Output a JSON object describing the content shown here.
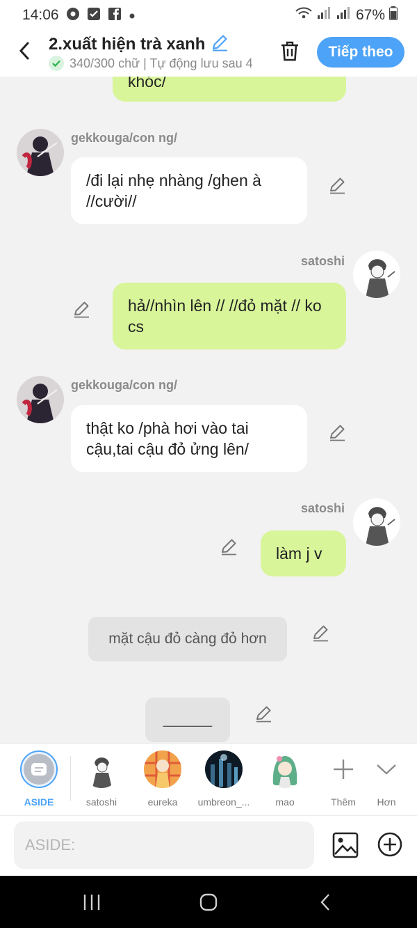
{
  "status_bar": {
    "time": "14:06",
    "battery": "67%"
  },
  "header": {
    "title": "2.xuất hiện trà xanh",
    "subtitle": "340/300 chữ | Tự động lưu sau 4",
    "next_label": "Tiếp theo"
  },
  "messages": [
    {
      "text": "khóc/"
    },
    {
      "speaker": "gekkouga/con ng/",
      "text": "/đi lại nhẹ nhàng /ghen à //cười//"
    },
    {
      "speaker": "satoshi",
      "text": "hả//nhìn lên // //đỏ mặt // ko cs"
    },
    {
      "speaker": "gekkouga/con ng/",
      "text": "thật ko /phà hơi vào tai cậu,tai cậu đỏ ửng lên/"
    },
    {
      "speaker": "satoshi",
      "text": "làm j v"
    },
    {
      "text": "mặt cậu đỏ càng đỏ hơn"
    },
    {
      "text": "______"
    }
  ],
  "characters": [
    {
      "label": "ASIDE"
    },
    {
      "label": "satoshi"
    },
    {
      "label": "eureka"
    },
    {
      "label": "umbreon_..."
    },
    {
      "label": "mao"
    },
    {
      "label": "Thêm"
    },
    {
      "label": "Hơn"
    }
  ],
  "input": {
    "placeholder": "ASIDE:"
  },
  "colors": {
    "accent": "#4da3f7",
    "bubble_green": "#d8f59a",
    "bubble_white": "#ffffff"
  }
}
